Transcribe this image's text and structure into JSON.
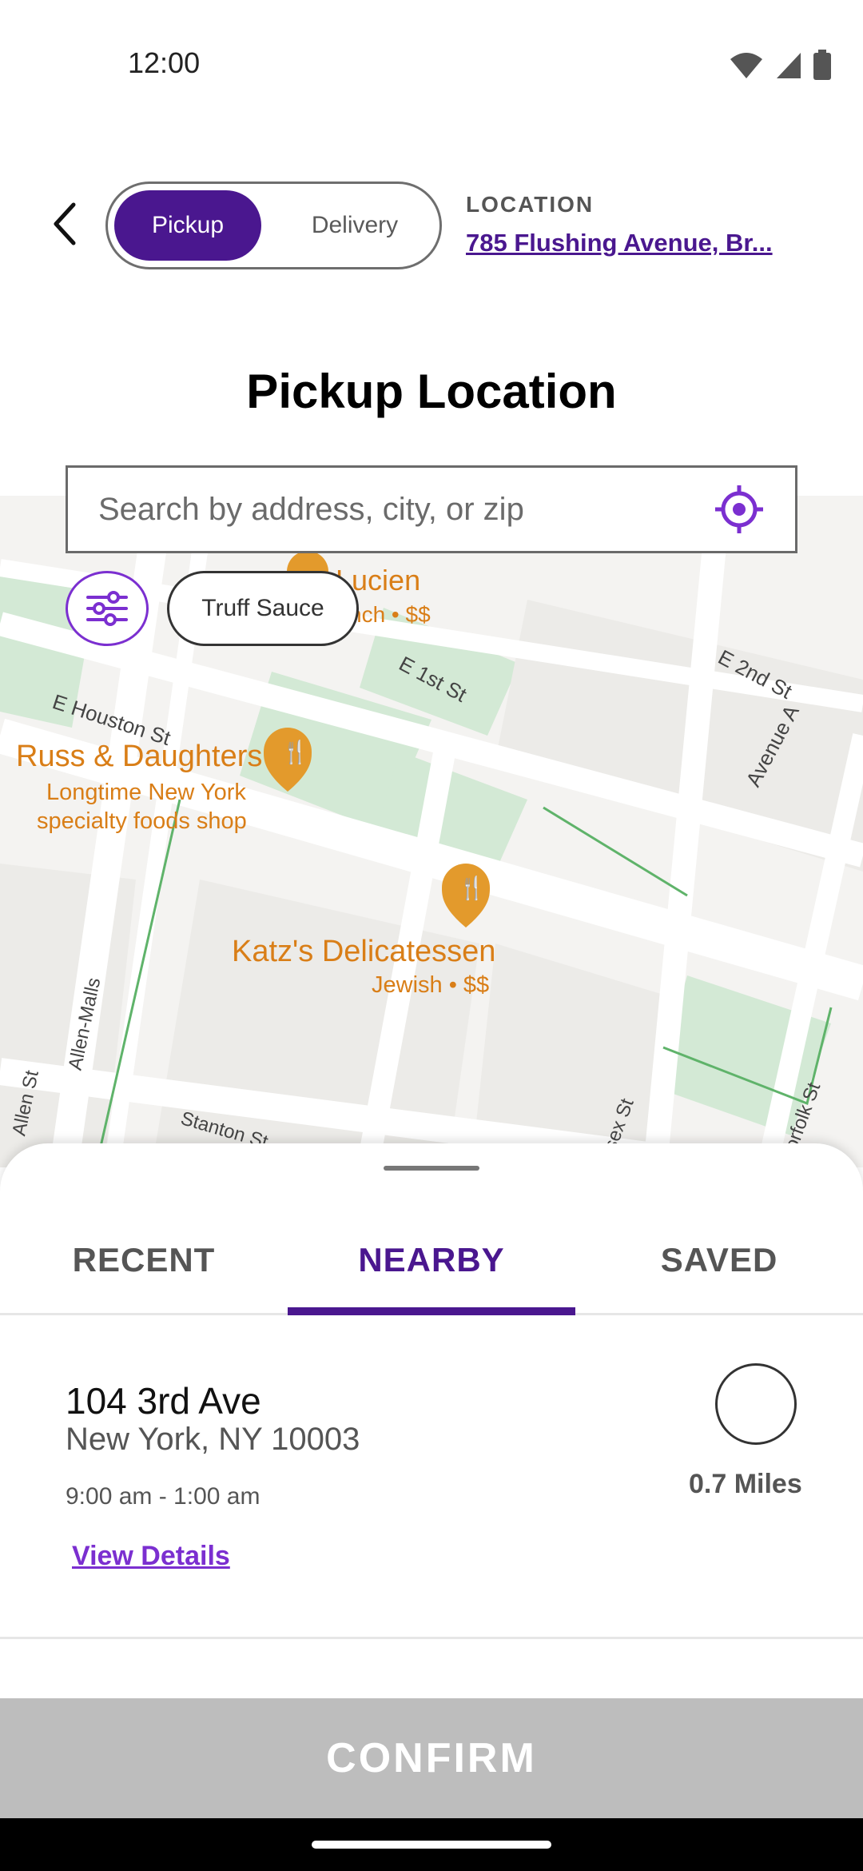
{
  "status_bar": {
    "time": "12:00"
  },
  "header": {
    "mode_active": "Pickup",
    "mode_inactive": "Delivery",
    "location_label": "LOCATION",
    "location_address": "785 Flushing Avenue, Br..."
  },
  "page": {
    "title": "Pickup Location"
  },
  "search": {
    "placeholder": "Search by address, city, or zip"
  },
  "filters": {
    "chip_label": "Truff Sauce"
  },
  "map": {
    "streets": [
      "E Houston St",
      "E 1st St",
      "E 2nd St",
      "Avenue A",
      "Allen-Malls",
      "Allen St",
      "Stanton St",
      "Essex St",
      "Norfolk St"
    ],
    "pois": [
      {
        "name": "Lucien",
        "detail": "French • $$"
      },
      {
        "name": "Russ & Daughters",
        "detail_line1": "Longtime New York",
        "detail_line2": "specialty foods shop"
      },
      {
        "name": "Katz's Delicatessen",
        "detail": "Jewish • $$"
      }
    ],
    "colors": {
      "poi": "#d97e17",
      "park": "#d3e9d5",
      "road": "#ffffff",
      "block": "#f4f3f1"
    }
  },
  "sheet": {
    "tabs": [
      "RECENT",
      "NEARBY",
      "SAVED"
    ],
    "active_tab": "NEARBY",
    "store": {
      "street": "104 3rd Ave",
      "city": "New York, NY 10003",
      "hours": "9:00 am - 1:00 am",
      "details_link": "View Details",
      "distance": "0.7 Miles"
    }
  },
  "footer": {
    "confirm_label": "CONFIRM"
  },
  "theme": {
    "accent": "#4a178f",
    "accent_light": "#7b2fd0",
    "disabled": "#bdbdbd"
  }
}
